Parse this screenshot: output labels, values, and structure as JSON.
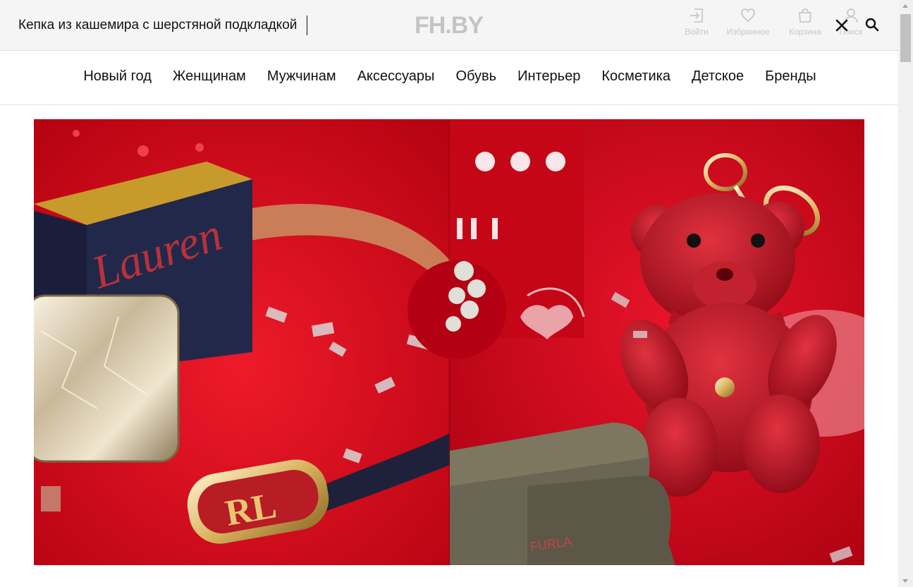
{
  "search": {
    "value": "Кепка из кашемира с шерстяной подкладкой",
    "placeholder": ""
  },
  "logo": {
    "text": "FH.BY"
  },
  "actions": [
    {
      "id": "login",
      "label": "Войти",
      "icon": "login-icon"
    },
    {
      "id": "favorites",
      "label": "Избранное",
      "icon": "heart-icon"
    },
    {
      "id": "cart",
      "label": "Корзина",
      "icon": "bag-icon"
    },
    {
      "id": "search",
      "label": "Поиск",
      "icon": "user-icon"
    }
  ],
  "nav": {
    "items": [
      "Новый год",
      "Женщинам",
      "Мужчинам",
      "Аксессуары",
      "Обувь",
      "Интерьер",
      "Косметика",
      "Детское",
      "Бренды"
    ]
  },
  "hero": {
    "left_box_text": "Lauren",
    "buckle_text": "RL",
    "tag_text": "FURLA"
  },
  "colors": {
    "hero_red": "#d90d1e",
    "header_bg": "#f5f5f5",
    "muted_icon": "#c8c8c8"
  }
}
